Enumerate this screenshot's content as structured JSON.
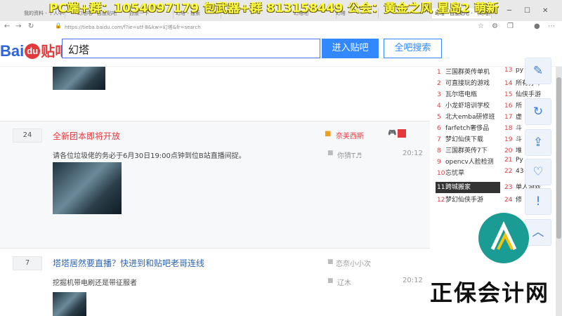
{
  "overlay": {
    "text": "PC端+群：1054097179  包武器+群 813158449  公会：黄金之风  星岛2 萌新"
  },
  "browser": {
    "tabs": [
      "我的资料 - 个人中心 - 九游",
      "幻塔吧 - 百度贴吧",
      "百度一下",
      "幻塔 - 搜索",
      "幻塔吧",
      "幻塔",
      "幻塔 - 百度贴吧 - （幻塔）"
    ],
    "url": "https://tieba.baidu.com/f?ie=utf-8&kw=幻塔&fr=search"
  },
  "header": {
    "logo": {
      "bai": "Bai",
      "du": "du",
      "tieba": "贴吧"
    },
    "search_value": "幻塔",
    "enter_label": "进入贴吧",
    "all_search_label": "全吧搜索"
  },
  "posts": [
    {
      "replies": "24",
      "title": "全新团本即将开放",
      "desc": "请各位垃圾佬的务必于6月30日19:00点钟到位B站直播间捉。",
      "author": "奈美西斯",
      "last_reply": "你猜T♬",
      "time": "20:12",
      "title_color": "#e4393c"
    },
    {
      "replies": "7",
      "title": "塔塔居然要直播？快进到和贴吧老哥连线",
      "desc": "挖掘机带电刷还是带征服者",
      "author": "恋奈小小次",
      "last_reply": "辽木",
      "time": "20:12",
      "title_color": "#2d64b3"
    }
  ],
  "hot_list": [
    {
      "num": "1",
      "name": "三国群英传单机"
    },
    {
      "num": "2",
      "name": "可直接玩的游戏"
    },
    {
      "num": "3",
      "name": "瓦尔塔电瓶"
    },
    {
      "num": "4",
      "name": "小龙虾培训学校"
    },
    {
      "num": "5",
      "name": "北大emba研修班"
    },
    {
      "num": "6",
      "name": "farfetch奢侈品"
    },
    {
      "num": "7",
      "name": "梦幻仙侠下载"
    },
    {
      "num": "8",
      "name": "三国群英传7下"
    },
    {
      "num": "9",
      "name": "opencv人脸检测"
    },
    {
      "num": "10",
      "name": "忘忧草"
    },
    {
      "num": "11",
      "name": "跨城搬家"
    },
    {
      "num": "12",
      "name": "梦幻仙侠手游"
    },
    {
      "num": "13",
      "name": "py"
    },
    {
      "num": "14",
      "name": "所有打斗"
    },
    {
      "num": "15",
      "name": "仙侠手游"
    },
    {
      "num": "16",
      "name": "所"
    },
    {
      "num": "17",
      "name": "虚"
    },
    {
      "num": "18",
      "name": "斗"
    },
    {
      "num": "19",
      "name": "斗"
    },
    {
      "num": "20",
      "name": "堆"
    },
    {
      "num": "21",
      "name": "Py"
    },
    {
      "num": "22",
      "name": "43"
    },
    {
      "num": "23",
      "name": "单人游戏"
    },
    {
      "num": "24",
      "name": "修"
    }
  ],
  "watermark": "正保会计网"
}
